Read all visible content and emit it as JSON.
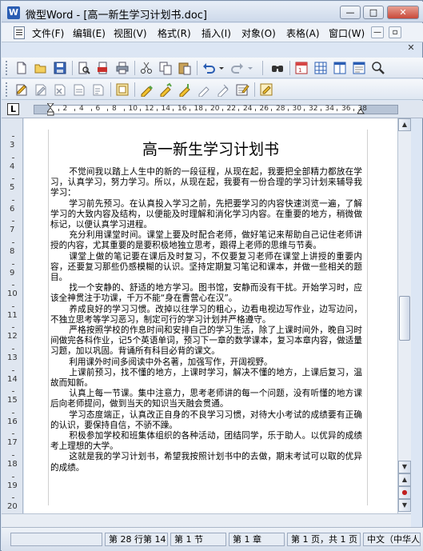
{
  "window": {
    "title": "微型Word - [高一新生学习计划书.doc]",
    "app_icon_letter": "W",
    "minimize": "—",
    "maximize": "□",
    "close": "✕"
  },
  "menu": {
    "items": [
      "文件(F)",
      "编辑(E)",
      "视图(V)",
      "格式(R)",
      "插入(I)",
      "对象(O)",
      "表格(A)",
      "窗口(W)"
    ],
    "mdi_min": "—",
    "mdi_restore": "▫",
    "mdi_close": "✕"
  },
  "toolbar1": {
    "icons": [
      "new-document-icon",
      "open-folder-icon",
      "save-icon",
      "print-preview-icon",
      "pdf-export-icon",
      "print-icon",
      "cut-icon",
      "copy-icon",
      "paste-icon",
      "undo-icon",
      "undo-dropdown-icon",
      "redo-icon",
      "redo-dropdown-icon",
      "find-icon",
      "insert-table-icon",
      "table-grid-icon",
      "columns-icon",
      "page-setup-icon",
      "zoom-icon"
    ]
  },
  "toolbar2": {
    "icons": [
      "new-object-icon",
      "edit-object-icon",
      "delete-object-icon",
      "object-properties-icon",
      "object-list-icon",
      "object-group-icon",
      "highlight-icon",
      "mark-icon",
      "mark-down-icon",
      "mark-clear-icon",
      "notes-icon",
      "revision-icon"
    ]
  },
  "ruler": {
    "corner": "L",
    "numbers": [
      "2",
      "4",
      "6",
      "8",
      "10",
      "12",
      "14",
      "16",
      "18",
      "20",
      "22",
      "24",
      "26",
      "28",
      "30",
      "32",
      "34",
      "36",
      "38"
    ]
  },
  "vruler": {
    "numbers": [
      "3",
      "4",
      "5",
      "6",
      "7",
      "8",
      "9",
      "10",
      "11",
      "12",
      "13",
      "14",
      "15",
      "16",
      "17",
      "18",
      "19",
      "20"
    ]
  },
  "document": {
    "title": "高一新生学习计划书",
    "paragraphs": [
      "不觉间我以踏上人生中的新的一段征程，从现在起，我要把全部精力都放在学习，认真学习，努力学习。所以，从现在起，我要有一份合理的学习计划来辅导我学习：",
      "学习前先预习。在认真投入学习之前，先把要学习的内容快速浏览一遍，了解学习的大致内容及结构，以便能及时理解和消化学习内容。在重要的地方，稍微做标记，以便认真学习进程。",
      "充分利用课堂时间。课堂上要及时配合老师，做好笔记来帮助自己记住老师讲授的内容，尤其重要的是要积极地独立思考，跟得上老师的思维与节奏。",
      "课堂上做的笔记要在课后及时复习，不仅要复习老师在课堂上讲授的重要内容，还要复习那些仍感模糊的认识。坚持定期复习笔记和课本，并做一些相关的题目。",
      "找一个安静的、舒适的地方学习。图书馆，安静而没有干扰。开始学习时，应该全神贯注于功课，千万不能“身在曹营心在汉”。",
      "养成良好的学习习惯。改掉以往学习的粗心，边看电视边写作业，边写边问，不独立思考等学习恶习，制定可行的学习计划并严格遵守。",
      "严格按照学校的作息时间和安排自己的学习生活，除了上课时间外，晚自习时间做完各科作业，记5个英语单词，预习下一章的数学课本，复习本章内容，做适量习题，加以巩固。背诵所有科目必背的课文。",
      "利用课外时间多阅读中外名著，加强写作，开阔视野。",
      "上课前预习，找不懂的地方，上课时学习，解决不懂的地方，上课后复习，温故而知新。",
      "认真上每一节课。集中注意力，思考老师讲的每一个问题，没有听懂的地方课后向老师提问，做到当天的知识当天融会贯通。",
      "学习态度端正，认真改正自身的不良学习习惯，对待大小考试的成绩要有正确的认识，要保持自信，不骄不躁。",
      "积极参加学校和班集体组织的各种活动，团结同学，乐于助人。以优异的成绩考上理想的大学。",
      "这就是我的学习计划书，希望我按照计划书中的去做，期末考试可以取的优异的成绩。"
    ]
  },
  "scrollbar": {
    "up": "▲",
    "down": "▼",
    "prev_page": "▲",
    "browse": "●",
    "next_page": "▼"
  },
  "status": {
    "line_col": "第 28 行第 14",
    "section": "第 1 节",
    "chapter": "第 1 章",
    "page": "第 1 页，共 1 页",
    "language": "中文（中华人民共和国）"
  }
}
